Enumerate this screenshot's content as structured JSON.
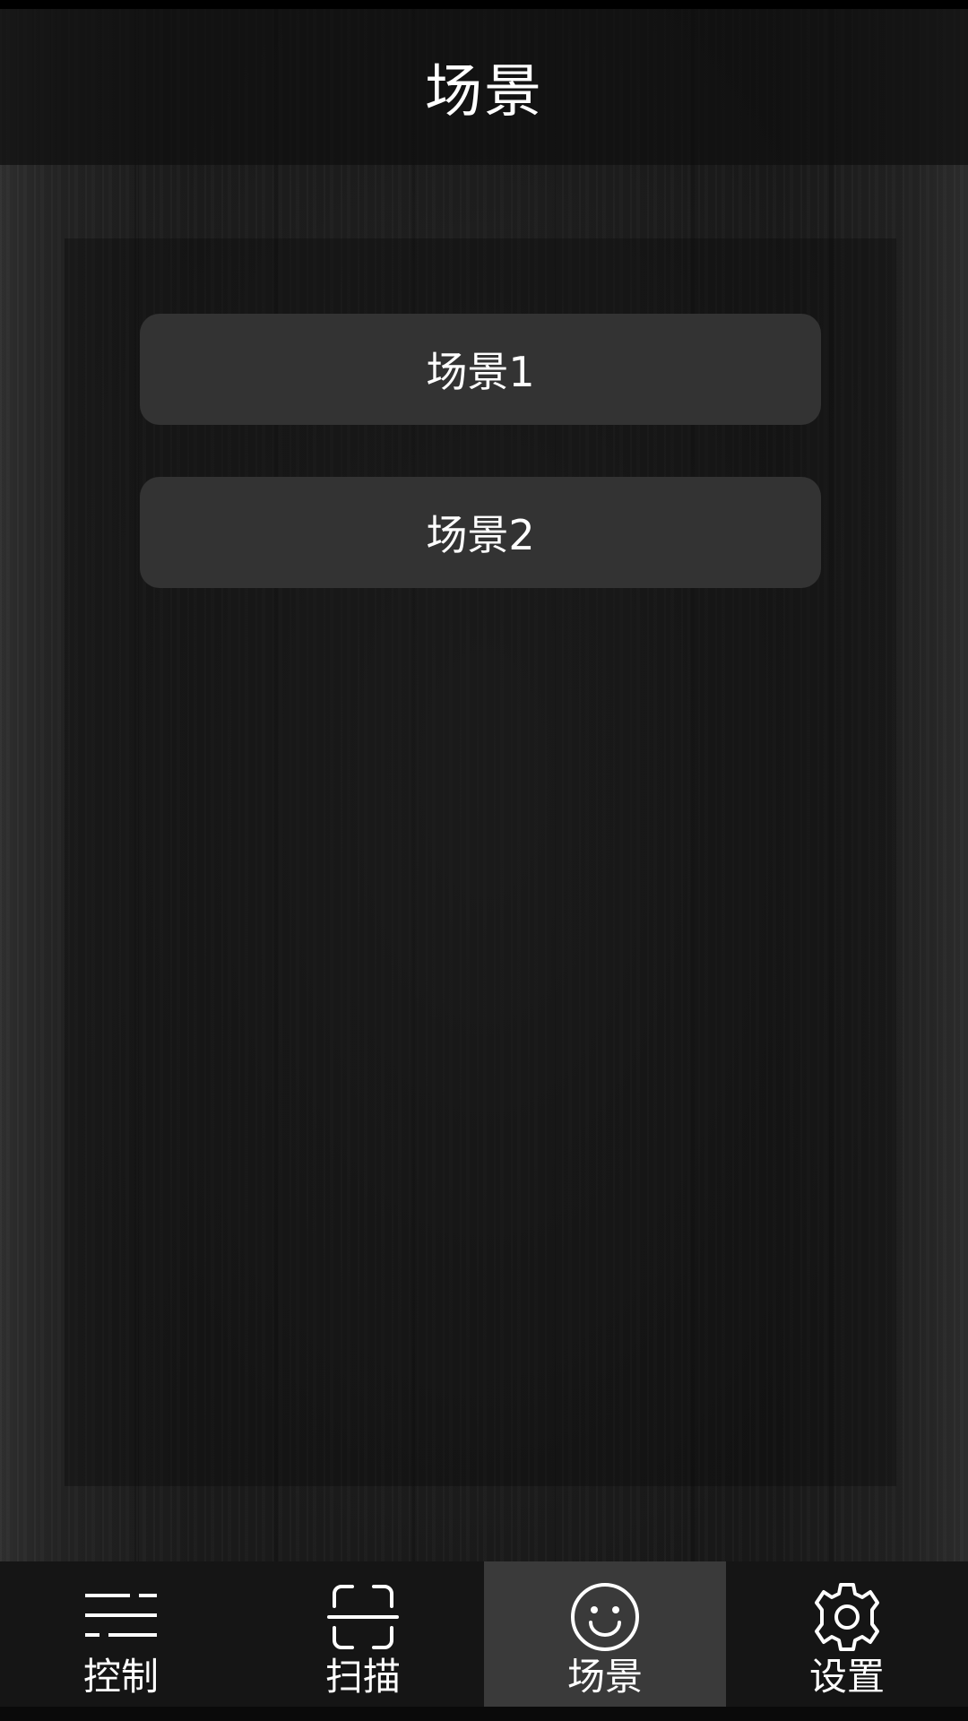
{
  "header": {
    "title": "场景"
  },
  "scenes": [
    {
      "label": "场景1"
    },
    {
      "label": "场景2"
    }
  ],
  "bottom_nav": {
    "active_index": 2,
    "items": [
      {
        "label": "控制",
        "icon": "sliders-icon"
      },
      {
        "label": "扫描",
        "icon": "scan-frame-icon"
      },
      {
        "label": "场景",
        "icon": "smiley-face-icon"
      },
      {
        "label": "设置",
        "icon": "gear-icon"
      }
    ]
  },
  "colors": {
    "header_text": "#ffffff",
    "scene_button_bg": "#333333",
    "nav_bg": "#151515",
    "nav_active_bg": "#3a3a3a"
  }
}
